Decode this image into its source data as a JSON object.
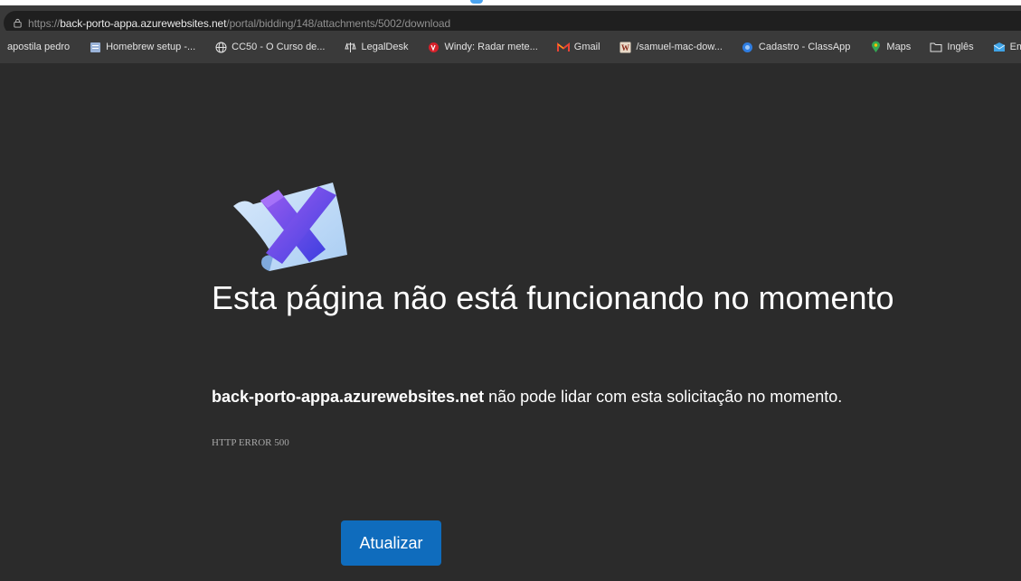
{
  "browser": {
    "url_prefix": "https://",
    "url_host": "back-porto-appa.azurewebsites.net",
    "url_path": "/portal/bidding/148/attachments/5002/download"
  },
  "bookmarks": [
    {
      "label": "apostila pedro",
      "icon": "none"
    },
    {
      "label": "Homebrew setup -...",
      "icon": "doc-icon",
      "color": "#9ab3d8"
    },
    {
      "label": "CC50 - O Curso de...",
      "icon": "globe-icon",
      "color": "#e3e3e3"
    },
    {
      "label": "LegalDesk",
      "icon": "scale-icon",
      "color": "#e3e3e3"
    },
    {
      "label": "Windy: Radar mete...",
      "icon": "windy-icon",
      "color": "#d6202a"
    },
    {
      "label": "Gmail",
      "icon": "gmail-icon",
      "color": "#ea4335"
    },
    {
      "label": "/samuel-mac-dow...",
      "icon": "w-icon",
      "color": "#e8d9c7"
    },
    {
      "label": "Cadastro - ClassApp",
      "icon": "classapp-icon",
      "color": "#2f7de1"
    },
    {
      "label": "Maps",
      "icon": "maps-icon",
      "color": "#34a853"
    },
    {
      "label": "Inglês",
      "icon": "folder-icon",
      "color": "#e3e3e3"
    },
    {
      "label": "Email AVA – JAIME...",
      "icon": "mail-icon",
      "color": "#3fa3e6"
    }
  ],
  "error": {
    "title": "Esta página não está funcionando no momento",
    "host": "back-porto-appa.azurewebsites.net",
    "message": " não pode lidar com esta solicitação no momento.",
    "code": "HTTP ERROR 500",
    "refresh_label": "Atualizar"
  },
  "colors": {
    "background": "#2b2b2b",
    "button": "#0f6cbd",
    "text": "#ffffff"
  }
}
